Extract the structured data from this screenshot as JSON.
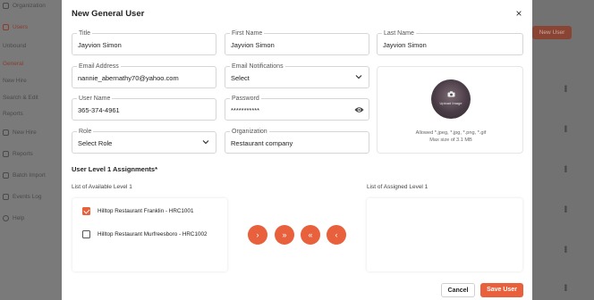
{
  "background": {
    "sidebar_items": [
      {
        "label": "Organization",
        "active": false
      },
      {
        "label": "Users",
        "active": true
      },
      {
        "label": "Unbound",
        "active": false
      },
      {
        "label": "General",
        "active": true
      },
      {
        "label": "New Hire",
        "active": false
      },
      {
        "label": "Search & Edit",
        "active": false
      },
      {
        "label": "Reports",
        "active": false
      },
      {
        "label": "New Hire",
        "active": false
      },
      {
        "label": "Reports",
        "active": false
      },
      {
        "label": "Batch Import",
        "active": false
      },
      {
        "label": "Events Log",
        "active": false
      },
      {
        "label": "Help",
        "active": false
      }
    ],
    "new_user_label": "New User"
  },
  "modal": {
    "title": "New General User",
    "close_label": "×",
    "fields": {
      "title": {
        "label": "Title",
        "value": "Jayvion Simon"
      },
      "first_name": {
        "label": "First Name",
        "value": "Jayvion Simon"
      },
      "last_name": {
        "label": "Last Name",
        "value": "Jayvion Simon"
      },
      "email": {
        "label": "Email Address",
        "value": "nannie_abernathy70@yahoo.com"
      },
      "email_notifications": {
        "label": "Email Notifications",
        "value": "Select"
      },
      "user_name": {
        "label": "User Name",
        "value": "365-374-4961"
      },
      "password": {
        "label": "Password",
        "value": "***********"
      },
      "role": {
        "label": "Role",
        "value": "Select Role"
      },
      "organization": {
        "label": "Organization",
        "value": "Restaurant company"
      }
    },
    "upload": {
      "label": "Upload Image",
      "allowed": "Allowed *.jpeg, *.jpg, *.png, *.gif",
      "max_size": "Max size of 3.1 MB"
    },
    "assignments": {
      "section_title": "User Level 1 Assignments*",
      "available_label": "List of Available Level 1",
      "assigned_label": "List of Assigned Level 1",
      "available_items": [
        {
          "label": "Hilltop Restaurant Franklin - HRC1001",
          "checked": true
        },
        {
          "label": "Hilltop Restaurant Murfreesboro - HRC1002",
          "checked": false
        }
      ],
      "move_buttons": [
        "›",
        "»",
        "«",
        "‹"
      ]
    },
    "footer": {
      "cancel_label": "Cancel",
      "save_label": "Save User"
    }
  }
}
